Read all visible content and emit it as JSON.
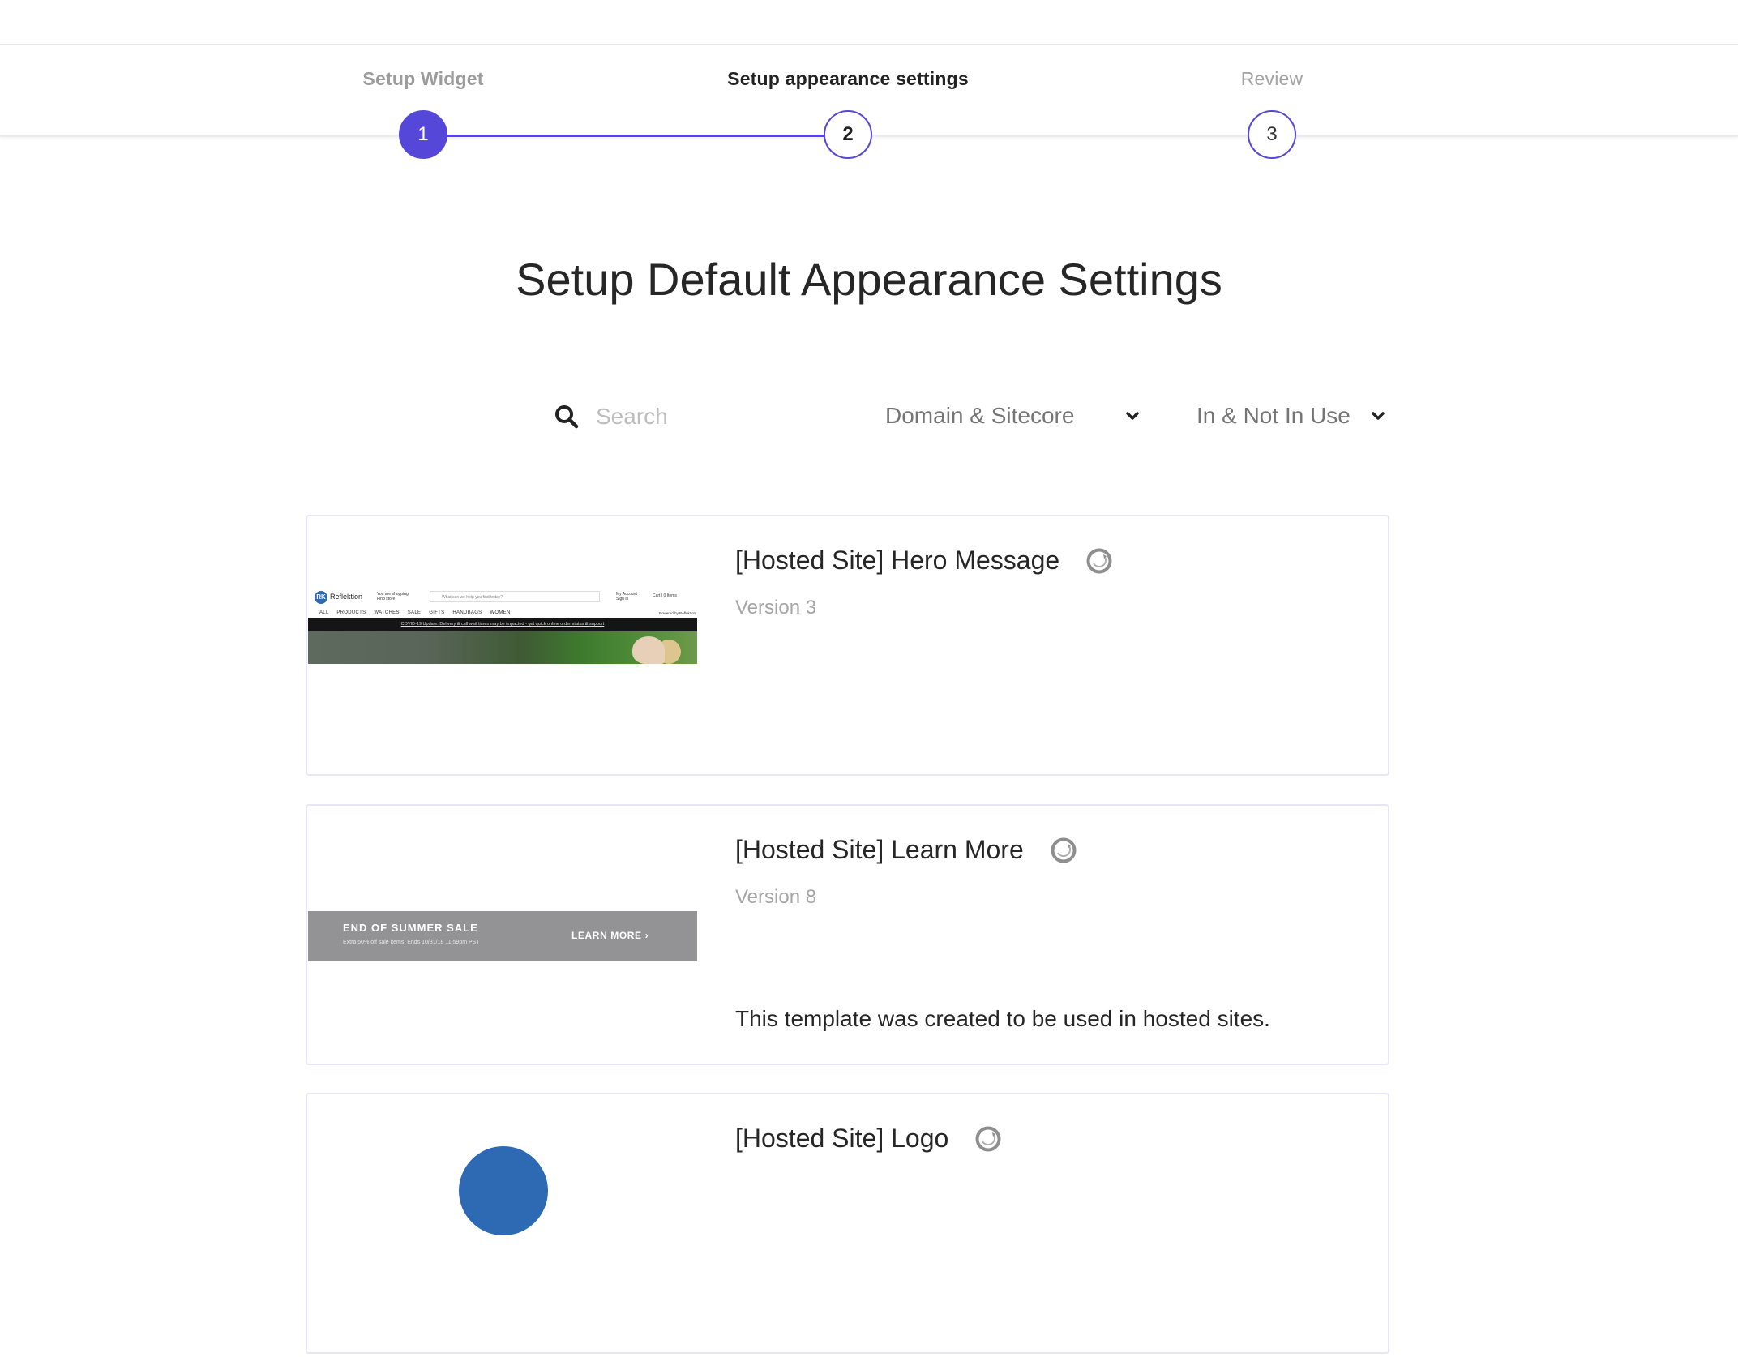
{
  "stepper": {
    "steps": [
      {
        "number": "1",
        "label": "Setup Widget",
        "state": "completed"
      },
      {
        "number": "2",
        "label": "Setup appearance settings",
        "state": "active"
      },
      {
        "number": "3",
        "label": "Review",
        "state": "upcoming"
      }
    ],
    "accent_color": "#5548d9"
  },
  "page": {
    "title": "Setup Default Appearance Settings"
  },
  "filters": {
    "search_placeholder": "Search",
    "search_value": "",
    "search_icon": "search-icon",
    "domain_dropdown": {
      "selected": "Domain & Sitecore",
      "icon": "chevron-down-icon"
    },
    "usage_dropdown": {
      "selected": "In & Not In Use",
      "icon": "chevron-down-icon"
    }
  },
  "templates": [
    {
      "title": "[Hosted Site] Hero Message",
      "version": "Version 3",
      "source_icon": "sitecore-icon",
      "description": "",
      "thumbnail": {
        "logo_text": "Reflektion",
        "logo_initials": "RK",
        "store_text": [
          "You are shopping",
          "Find store"
        ],
        "search_placeholder": "What can we help you find today?",
        "account_text": [
          "My Account",
          "Sign in"
        ],
        "cart_text": "Cart | 0 Items",
        "nav": "ALL PRODUCTS WATCHES SALE GIFTS HANDBAGS WOMEN",
        "powered_by": "Powered by Reflektion",
        "notice": "COVID-19 Update: Delivery & call wait times may be impacted - get quick online order status & support"
      }
    },
    {
      "title": "[Hosted Site] Learn More",
      "version": "Version 8",
      "source_icon": "sitecore-icon",
      "description": "This template was created to be used in hosted sites.",
      "thumbnail": {
        "heading": "END OF SUMMER SALE",
        "subtext": "Extra 50% off sale items. Ends 10/31/18 11:59pm PST",
        "cta": "LEARN MORE ›"
      }
    },
    {
      "title": "[Hosted Site] Logo",
      "version": "",
      "source_icon": "sitecore-icon",
      "description": "",
      "thumbnail": {
        "shape": "blue-circle",
        "color": "#2d6ab3"
      }
    }
  ]
}
